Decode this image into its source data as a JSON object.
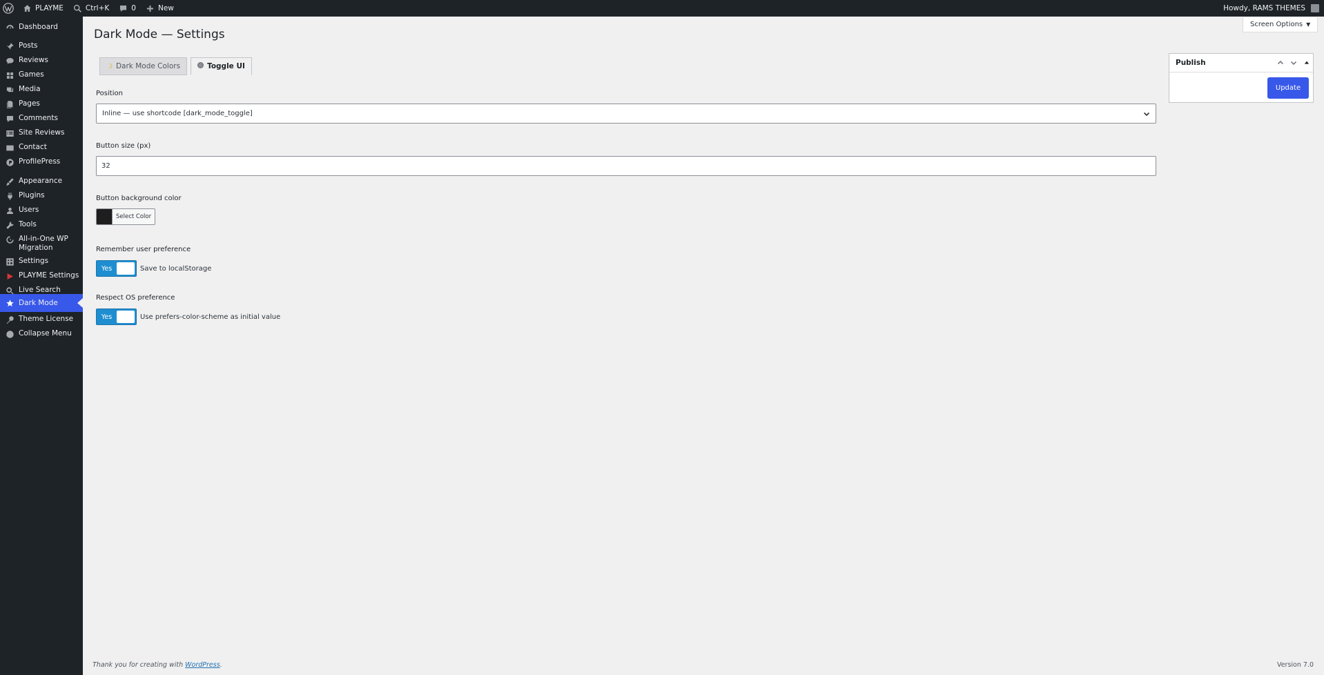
{
  "adminbar": {
    "site_name": "PLAYME",
    "search_label": "Ctrl+K",
    "comments_count": "0",
    "new_label": "New",
    "howdy": "Howdy, RAMS THEMES"
  },
  "sidebar": {
    "items": [
      {
        "label": "Dashboard",
        "icon": "dashboard-icon"
      },
      {
        "label": "Posts",
        "icon": "pin-icon"
      },
      {
        "label": "Reviews",
        "icon": "speech-bubble-icon"
      },
      {
        "label": "Games",
        "icon": "grid-icon"
      },
      {
        "label": "Media",
        "icon": "media-icon"
      },
      {
        "label": "Pages",
        "icon": "pages-icon"
      },
      {
        "label": "Comments",
        "icon": "comment-icon"
      },
      {
        "label": "Site Reviews",
        "icon": "list-icon"
      },
      {
        "label": "Contact",
        "icon": "envelope-icon"
      },
      {
        "label": "ProfilePress",
        "icon": "profilepress-icon"
      },
      {
        "label": "Appearance",
        "icon": "paintbrush-icon"
      },
      {
        "label": "Plugins",
        "icon": "plug-icon"
      },
      {
        "label": "Users",
        "icon": "user-icon"
      },
      {
        "label": "Tools",
        "icon": "wrench-icon"
      },
      {
        "label": "All-in-One WP Migration",
        "icon": "migration-icon"
      },
      {
        "label": "Settings",
        "icon": "settings-icon"
      },
      {
        "label": "PLAYME Settings",
        "icon": "play-icon"
      },
      {
        "label": "Live Search",
        "icon": "search-icon"
      },
      {
        "label": "Dark Mode",
        "icon": "star-icon"
      },
      {
        "label": "Theme License",
        "icon": "key-icon"
      },
      {
        "label": "Collapse Menu",
        "icon": "collapse-icon"
      }
    ]
  },
  "header": {
    "title": "Dark Mode — Settings",
    "screen_options": "Screen Options"
  },
  "tabs": [
    {
      "label": "Dark Mode Colors",
      "active": false
    },
    {
      "label": "Toggle UI",
      "active": true
    }
  ],
  "form": {
    "position_label": "Position",
    "position_value": "Inline — use shortcode [dark_mode_toggle]",
    "button_size_label": "Button size (px)",
    "button_size_value": "32",
    "bg_color_label": "Button background color",
    "bg_color_value": "#1e1e1e",
    "select_color_label": "Select Color",
    "remember_label": "Remember user preference",
    "remember_toggle": "Yes",
    "remember_desc": "Save to localStorage",
    "os_label": "Respect OS preference",
    "os_toggle": "Yes",
    "os_desc": "Use prefers-color-scheme as initial value"
  },
  "publish": {
    "title": "Publish",
    "update_label": "Update"
  },
  "footer": {
    "thanks_prefix": "Thank you for creating with ",
    "wordpress_link": "WordPress",
    "thanks_suffix": ".",
    "version": "Version 7.0"
  },
  "colors": {
    "accent": "#3858e9",
    "toggle": "#1f8ed0",
    "sidebar_bg": "#1d2327"
  }
}
